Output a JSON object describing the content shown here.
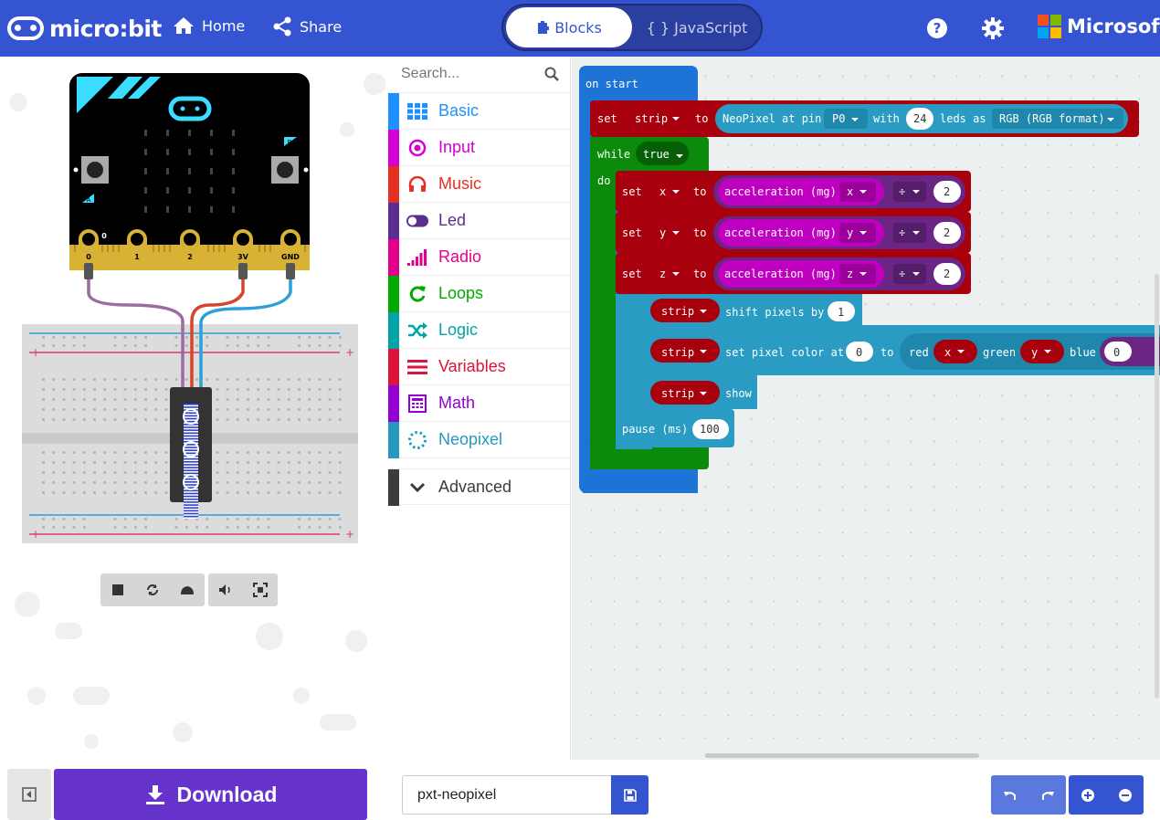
{
  "header": {
    "brand": "micro:bit",
    "home_label": "Home",
    "share_label": "Share",
    "tabs": [
      {
        "label": "Blocks"
      },
      {
        "label": "{ } JavaScript"
      }
    ],
    "company": "Microsoft",
    "colors": {
      "header": "#3454d1",
      "active_tab_text": "#3454d1"
    }
  },
  "simulator": {
    "pin_labels": [
      "0",
      "1",
      "2",
      "3V",
      "GND"
    ],
    "button_labels": [
      "A",
      "B"
    ],
    "controls": [
      "stop-icon",
      "restart-icon",
      "slowmo-icon",
      "mute-icon",
      "fullscreen-icon"
    ]
  },
  "toolbox": {
    "search_placeholder": "Search...",
    "categories": [
      {
        "label": "Basic",
        "color": "#1e90ff",
        "icon": "grid-icon"
      },
      {
        "label": "Input",
        "color": "#d400d4",
        "icon": "target-icon"
      },
      {
        "label": "Music",
        "color": "#e63022",
        "icon": "headphones-icon"
      },
      {
        "label": "Led",
        "color": "#5c2d91",
        "icon": "toggle-icon"
      },
      {
        "label": "Radio",
        "color": "#e3008c",
        "icon": "signal-icon"
      },
      {
        "label": "Loops",
        "color": "#00aa00",
        "icon": "refresh-icon"
      },
      {
        "label": "Logic",
        "color": "#00a4a6",
        "icon": "shuffle-icon"
      },
      {
        "label": "Variables",
        "color": "#dc143c",
        "icon": "list-icon"
      },
      {
        "label": "Math",
        "color": "#9400d3",
        "icon": "calculator-icon"
      },
      {
        "label": "Neopixel",
        "color": "#2699bf",
        "icon": "dotted-circle-icon"
      }
    ],
    "advanced_label": "Advanced"
  },
  "workspace": {
    "on_start": "on start",
    "set_strip": {
      "set": "set",
      "var": "strip",
      "to": "to",
      "neopixel": "NeoPixel at pin",
      "pin": "P0",
      "with": "with",
      "leds": "24",
      "leds_as": "leds as",
      "format": "RGB (RGB format)"
    },
    "while": {
      "label": "while",
      "cond": "true",
      "do": "do"
    },
    "set_rows": [
      {
        "set": "set",
        "var": "x",
        "to": "to",
        "fn": "acceleration (mg)",
        "axis": "x",
        "op": "÷",
        "num": "2"
      },
      {
        "set": "set",
        "var": "y",
        "to": "to",
        "fn": "acceleration (mg)",
        "axis": "y",
        "op": "÷",
        "num": "2"
      },
      {
        "set": "set",
        "var": "z",
        "to": "to",
        "fn": "acceleration (mg)",
        "axis": "z",
        "op": "÷",
        "num": "2"
      }
    ],
    "shift": {
      "var": "strip",
      "label": "shift pixels by",
      "num": "1"
    },
    "setpixel": {
      "var": "strip",
      "label": "set pixel color at",
      "idx": "0",
      "to": "to",
      "red": "red",
      "rv": "x",
      "green": "green",
      "gv": "y",
      "blue": "blue",
      "bv": "0"
    },
    "show": {
      "var": "strip",
      "label": "show"
    },
    "pause": {
      "label": "pause (ms)",
      "num": "100"
    }
  },
  "footer": {
    "download_label": "Download",
    "project_name": "pxt-neopixel"
  }
}
